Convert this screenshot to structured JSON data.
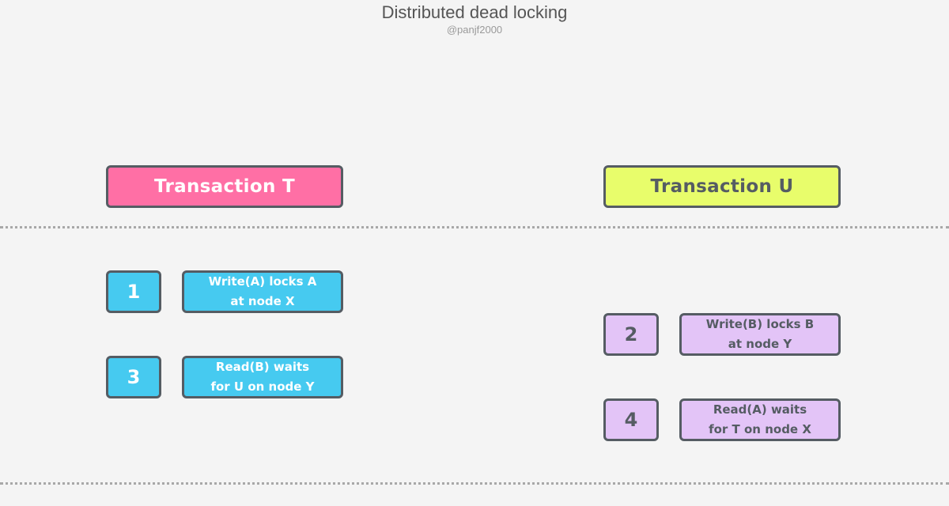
{
  "title": "Distributed dead locking",
  "subtitle": "@panjf2000",
  "colors": {
    "transaction_t": "#ff6fa5",
    "transaction_u": "#e8fd6b",
    "transaction_t_steps": "#46caf0",
    "transaction_u_steps": "#e3c4f7",
    "border": "#555c63"
  },
  "transactions": {
    "t": {
      "label": "Transaction T",
      "steps": [
        {
          "number": "1",
          "text_line1": "Write(A) locks A",
          "text_line2": "at node X"
        },
        {
          "number": "3",
          "text_line1": "Read(B) waits",
          "text_line2": "for U on node Y"
        }
      ]
    },
    "u": {
      "label": "Transaction U",
      "steps": [
        {
          "number": "2",
          "text_line1": "Write(B) locks B",
          "text_line2": "at node Y"
        },
        {
          "number": "4",
          "text_line1": "Read(A) waits",
          "text_line2": "for T on node X"
        }
      ]
    }
  }
}
